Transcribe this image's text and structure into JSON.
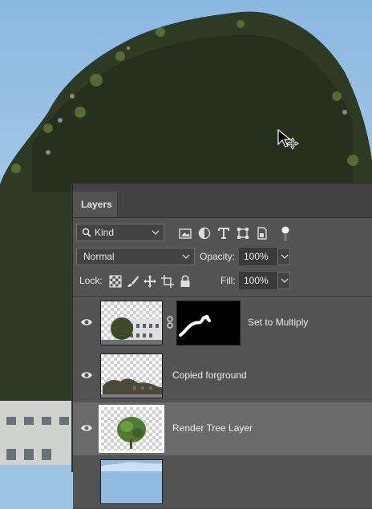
{
  "panel": {
    "tab_label": "Layers",
    "filter": {
      "selected": "Kind",
      "icons": [
        "image-filter-icon",
        "adjustment-filter-icon",
        "type-filter-icon",
        "shape-filter-icon",
        "smart-object-filter-icon",
        "filter-toggle-icon"
      ]
    },
    "blend_mode": "Normal",
    "opacity_label": "Opacity:",
    "opacity_value": "100%",
    "lock_label": "Lock:",
    "lock_icons": [
      "lock-transparent-pixels-icon",
      "lock-image-pixels-icon",
      "lock-position-icon",
      "lock-artboard-icon",
      "lock-all-icon"
    ],
    "fill_label": "Fill:",
    "fill_value": "100%"
  },
  "layers": [
    {
      "name": "Set to Multiply",
      "visible": true,
      "has_mask": true,
      "selected": false
    },
    {
      "name": "Copied forground",
      "visible": true,
      "has_mask": false,
      "selected": false
    },
    {
      "name": "Render Tree Layer",
      "visible": true,
      "has_mask": false,
      "selected": true
    },
    {
      "name": "",
      "visible": true,
      "has_mask": false,
      "selected": false
    }
  ],
  "colors": {
    "panel_bg": "#535353",
    "tab_bar_bg": "#424242",
    "selected_row": "#6a6a6a",
    "sky": "#9cc4e4"
  }
}
